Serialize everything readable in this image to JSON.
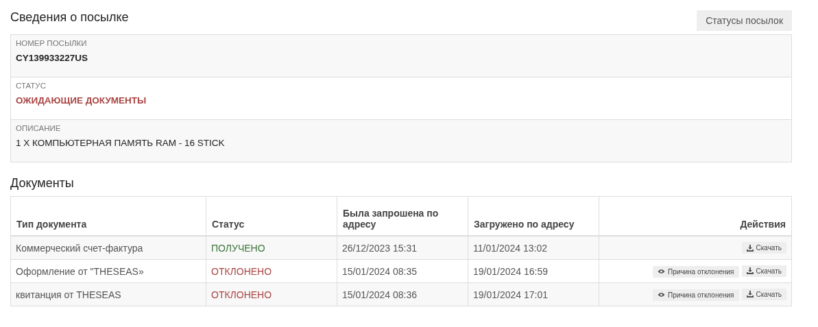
{
  "parcel": {
    "title": "Сведения о посылке",
    "statuses_button": "Статусы посылок",
    "fields": [
      {
        "label": "НОМЕР ПОСЫЛКИ",
        "value": "CY139933227US",
        "kind": "bold"
      },
      {
        "label": "СТАТУС",
        "value": "ОЖИДАЮЩИЕ ДОКУМЕНТЫ",
        "kind": "alert"
      },
      {
        "label": "ОПИСАНИЕ",
        "value": "1 X КОМПЬЮТЕРНАЯ ПАМЯТЬ RAM - 16 STICK",
        "kind": "plain"
      }
    ]
  },
  "documents": {
    "title": "Документы",
    "columns": [
      "Тип документа",
      "Статус",
      "Была запрошена по адресу",
      "Загружено по адресу",
      "Действия"
    ],
    "rows": [
      {
        "type": "Коммерческий счет-фактура",
        "status": "ПОЛУЧЕНО",
        "kind": "received",
        "requested": "26/12/2023 15:31",
        "uploaded": "11/01/2024 13:02",
        "actions": [
          {
            "label": "Скачать",
            "kind": "download"
          }
        ]
      },
      {
        "type": "Оформление от \"THESEAS»",
        "status": "ОТКЛОНЕНО",
        "kind": "rejected",
        "requested": "15/01/2024 08:35",
        "uploaded": "19/01/2024 16:59",
        "actions": [
          {
            "label": "Причина отклонения",
            "kind": "reason"
          },
          {
            "label": "Скачать",
            "kind": "download"
          }
        ]
      },
      {
        "type": "квитанция от THESEAS",
        "status": "ОТКЛОНЕНО",
        "kind": "rejected",
        "requested": "15/01/2024 08:36",
        "uploaded": "19/01/2024 17:01",
        "actions": [
          {
            "label": "Причина отклонения",
            "kind": "reason"
          },
          {
            "label": "Скачать",
            "kind": "download"
          }
        ]
      }
    ]
  }
}
